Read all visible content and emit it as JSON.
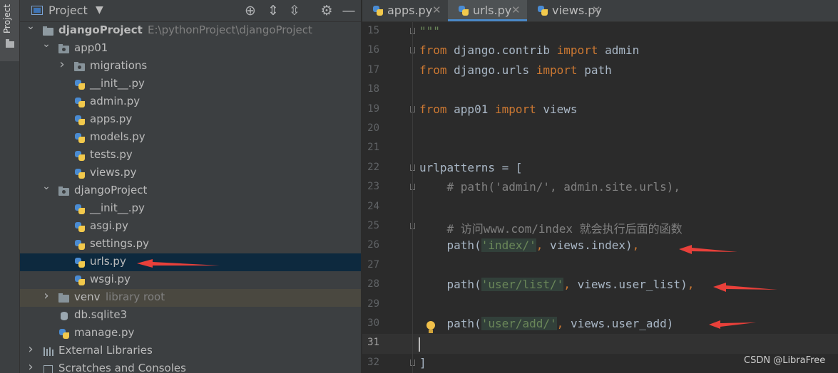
{
  "stripe": {
    "label": "Project"
  },
  "panel": {
    "title": "Project",
    "header_icons": [
      "locate-icon",
      "expand-all-icon",
      "collapse-all-icon",
      "gear-icon",
      "minimize-icon"
    ]
  },
  "tree": [
    {
      "label": "djangoProject",
      "hint": "E:\\pythonProject\\djangoProject",
      "icon": "project-folder-icon",
      "depth": 0,
      "expanded": true,
      "bold": true
    },
    {
      "label": "app01",
      "icon": "package-folder-icon",
      "depth": 1,
      "expanded": true
    },
    {
      "label": "migrations",
      "icon": "package-folder-icon",
      "depth": 2,
      "expanded": false
    },
    {
      "label": "__init__.py",
      "icon": "python-file-icon",
      "depth": 2
    },
    {
      "label": "admin.py",
      "icon": "python-file-icon",
      "depth": 2
    },
    {
      "label": "apps.py",
      "icon": "python-file-icon",
      "depth": 2
    },
    {
      "label": "models.py",
      "icon": "python-file-icon",
      "depth": 2
    },
    {
      "label": "tests.py",
      "icon": "python-file-icon",
      "depth": 2
    },
    {
      "label": "views.py",
      "icon": "python-file-icon",
      "depth": 2
    },
    {
      "label": "djangoProject",
      "icon": "package-folder-icon",
      "depth": 1,
      "expanded": true
    },
    {
      "label": "__init__.py",
      "icon": "python-file-icon",
      "depth": 2
    },
    {
      "label": "asgi.py",
      "icon": "python-file-icon",
      "depth": 2
    },
    {
      "label": "settings.py",
      "icon": "python-file-icon",
      "depth": 2
    },
    {
      "label": "urls.py",
      "icon": "python-file-icon",
      "depth": 2,
      "selected": true
    },
    {
      "label": "wsgi.py",
      "icon": "python-file-icon",
      "depth": 2
    },
    {
      "label": "venv",
      "hint": "library root",
      "icon": "folder-icon",
      "depth": 1,
      "expanded": false,
      "excluded": true
    },
    {
      "label": "db.sqlite3",
      "icon": "database-file-icon",
      "depth": 1
    },
    {
      "label": "manage.py",
      "icon": "python-file-icon",
      "depth": 1
    },
    {
      "label": "External Libraries",
      "icon": "libraries-icon",
      "depth": 0,
      "expanded": false
    },
    {
      "label": "Scratches and Consoles",
      "icon": "scratches-icon",
      "depth": 0,
      "expanded": false
    }
  ],
  "tabs": [
    {
      "label": "apps.py",
      "active": false
    },
    {
      "label": "urls.py",
      "active": true
    },
    {
      "label": "views.py",
      "active": false
    }
  ],
  "editor": {
    "current_line": 31,
    "lines": [
      {
        "n": 15,
        "tokens": [
          [
            "str",
            "\"\"\""
          ]
        ],
        "fold": true
      },
      {
        "n": 16,
        "tokens": [
          [
            "kw",
            "from"
          ],
          [
            "",
            " django.contrib "
          ],
          [
            "kw",
            "import"
          ],
          [
            "",
            " admin"
          ]
        ],
        "fold": true,
        "dim": true
      },
      {
        "n": 17,
        "tokens": [
          [
            "kw",
            "from"
          ],
          [
            "",
            " django.urls "
          ],
          [
            "kw",
            "import"
          ],
          [
            "",
            " path"
          ]
        ]
      },
      {
        "n": 18,
        "tokens": []
      },
      {
        "n": 19,
        "tokens": [
          [
            "kw",
            "from"
          ],
          [
            "",
            " app01 "
          ],
          [
            "kw",
            "import"
          ],
          [
            "",
            " views"
          ]
        ],
        "fold": true
      },
      {
        "n": 20,
        "tokens": []
      },
      {
        "n": 21,
        "tokens": []
      },
      {
        "n": 22,
        "tokens": [
          [
            "",
            "urlpatterns = ["
          ]
        ],
        "fold": true
      },
      {
        "n": 23,
        "tokens": [
          [
            "cmt",
            "    # path('admin/', admin.site.urls),"
          ]
        ],
        "fold": true
      },
      {
        "n": 24,
        "tokens": []
      },
      {
        "n": 25,
        "tokens": [
          [
            "cmt",
            "    # 访问www.com/index 就会执行后面的函数"
          ]
        ],
        "fold": true
      },
      {
        "n": 26,
        "tokens": [
          [
            "",
            "    path("
          ],
          [
            "strhl",
            "'index/'"
          ],
          [
            "kw",
            ","
          ],
          [
            "",
            " views.index)"
          ],
          [
            "kw",
            ","
          ]
        ]
      },
      {
        "n": 27,
        "tokens": []
      },
      {
        "n": 28,
        "tokens": [
          [
            "",
            "    path("
          ],
          [
            "strhl",
            "'user/list/'"
          ],
          [
            "kw",
            ","
          ],
          [
            "",
            " views.user_list)"
          ],
          [
            "kw",
            ","
          ]
        ]
      },
      {
        "n": 29,
        "tokens": []
      },
      {
        "n": 30,
        "tokens": [
          [
            "",
            "    path("
          ],
          [
            "strhl",
            "'user/add/'"
          ],
          [
            "kw",
            ","
          ],
          [
            "",
            " views.user_add)"
          ]
        ]
      },
      {
        "n": 31,
        "tokens": []
      },
      {
        "n": 32,
        "tokens": [
          [
            "",
            "]"
          ]
        ],
        "fold": true
      }
    ]
  },
  "annotations": {
    "color": "#e8403a"
  },
  "watermark": "CSDN @LibraFree"
}
